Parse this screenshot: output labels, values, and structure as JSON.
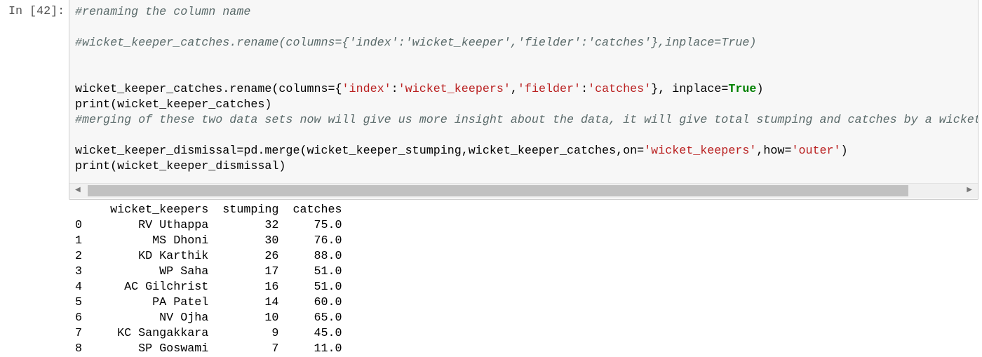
{
  "cell": {
    "prompt": "In [42]:",
    "code_lines": [
      [
        {
          "t": "#renaming the column name",
          "c": "cm"
        }
      ],
      [],
      [
        {
          "t": "#wicket_keeper_catches.rename(columns={'index':'wicket_keeper','fielder':'catches'},inplace=True)",
          "c": "cm"
        }
      ],
      [],
      [],
      [
        {
          "t": "wicket_keeper_catches.rename(columns={",
          "c": ""
        },
        {
          "t": "'index'",
          "c": "st"
        },
        {
          "t": ":",
          "c": ""
        },
        {
          "t": "'wicket_keepers'",
          "c": "st"
        },
        {
          "t": ",",
          "c": ""
        },
        {
          "t": "'fielder'",
          "c": "st"
        },
        {
          "t": ":",
          "c": ""
        },
        {
          "t": "'catches'",
          "c": "st"
        },
        {
          "t": "}, inplace=",
          "c": ""
        },
        {
          "t": "True",
          "c": "kw"
        },
        {
          "t": ")",
          "c": ""
        }
      ],
      [
        {
          "t": "print(wicket_keeper_catches)",
          "c": ""
        }
      ],
      [
        {
          "t": "#merging of these two data sets now will give us more insight about the data, it will give total stumping and catches by a wicket",
          "c": "cm"
        }
      ],
      [],
      [
        {
          "t": "wicket_keeper_dismissal=pd.merge(wicket_keeper_stumping,wicket_keeper_catches,on=",
          "c": ""
        },
        {
          "t": "'wicket_keepers'",
          "c": "st"
        },
        {
          "t": ",how=",
          "c": ""
        },
        {
          "t": "'outer'",
          "c": "st"
        },
        {
          "t": ")",
          "c": ""
        }
      ],
      [
        {
          "t": "print(wicket_keeper_dismissal)",
          "c": ""
        }
      ]
    ]
  },
  "output": {
    "columns": [
      "",
      "wicket_keepers",
      "stumping",
      "catches"
    ],
    "rows": [
      [
        "0",
        "RV Uthappa",
        "32",
        "75.0"
      ],
      [
        "1",
        "MS Dhoni",
        "30",
        "76.0"
      ],
      [
        "2",
        "KD Karthik",
        "26",
        "88.0"
      ],
      [
        "3",
        "WP Saha",
        "17",
        "51.0"
      ],
      [
        "4",
        "AC Gilchrist",
        "16",
        "51.0"
      ],
      [
        "5",
        "PA Patel",
        "14",
        "60.0"
      ],
      [
        "6",
        "NV Ojha",
        "10",
        "65.0"
      ],
      [
        "7",
        "KC Sangakkara",
        "9",
        "45.0"
      ],
      [
        "8",
        "SP Goswami",
        "7",
        "11.0"
      ]
    ]
  }
}
